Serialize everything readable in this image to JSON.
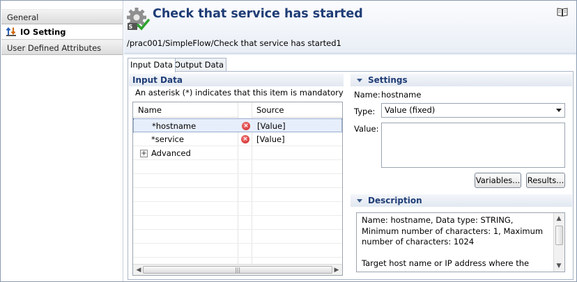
{
  "nav": {
    "items": [
      {
        "label": "General"
      },
      {
        "label": "IO Setting"
      },
      {
        "label": "User Defined Attributes"
      }
    ]
  },
  "header": {
    "title": "Check that service has started",
    "path": "/prac001/SimpleFlow/Check that service has started1",
    "icons": [
      "gear-check-icon",
      "book-icon"
    ]
  },
  "tabs": [
    {
      "label": "Input Data"
    },
    {
      "label": "Output Data"
    }
  ],
  "input_data": {
    "heading": "Input Data",
    "note": "An asterisk (*) indicates that this item is mandatory",
    "columns": [
      "Name",
      "Source"
    ],
    "rows": [
      {
        "name": "*hostname",
        "source": "[Value]",
        "error": true
      },
      {
        "name": "*service",
        "source": "[Value]",
        "error": true
      },
      {
        "name": "Advanced",
        "source": "",
        "error": false
      }
    ]
  },
  "settings": {
    "heading": "Settings",
    "name_label": "Name:",
    "name_value": "hostname",
    "type_label": "Type:",
    "type_value": "Value (fixed)",
    "value_label": "Value:",
    "variables_button": "Variables...",
    "results_button": "Results..."
  },
  "description": {
    "heading": "Description",
    "text1": "Name: hostname, Data type: STRING, Minimum number of characters: 1, Maximum number of characters: 1024",
    "text2": "Target host name or IP address where the"
  },
  "colors": {
    "title": "#1f3d76",
    "error": "#cc2222"
  }
}
